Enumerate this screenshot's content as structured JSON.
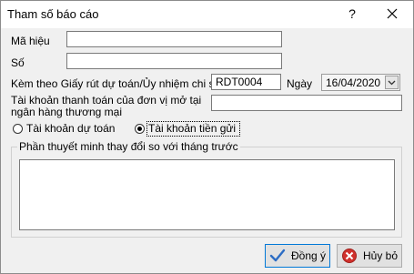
{
  "window": {
    "title": "Tham số báo cáo",
    "help_glyph": "?"
  },
  "form": {
    "ma_hieu_label": "Mã hiệu",
    "ma_hieu_value": "",
    "so_label": "Số",
    "so_value": "",
    "kem_theo_label": "Kèm theo Giấy rút dự toán/Ủy nhiệm chi số",
    "kem_theo_value": "RDT0004",
    "ngay_label": "Ngày",
    "ngay_value": "16/04/2020",
    "tai_khoan_label_line1": "Tài khoản thanh toán của đơn vị mở tại",
    "tai_khoan_label_line2": "ngân hàng thương mại",
    "tai_khoan_value": ""
  },
  "radios": [
    {
      "label": "Tài khoản dự toán",
      "selected": false
    },
    {
      "label": "Tài khoản tiền gửi",
      "selected": true
    }
  ],
  "group": {
    "legend": "Phần thuyết minh thay đổi so với tháng trước",
    "memo_value": ""
  },
  "buttons": {
    "ok_label": "Đồng ý",
    "cancel_label": "Hủy bỏ"
  },
  "colors": {
    "ok_check": "#2b6cc4",
    "cancel_icon": "#d0312d"
  }
}
